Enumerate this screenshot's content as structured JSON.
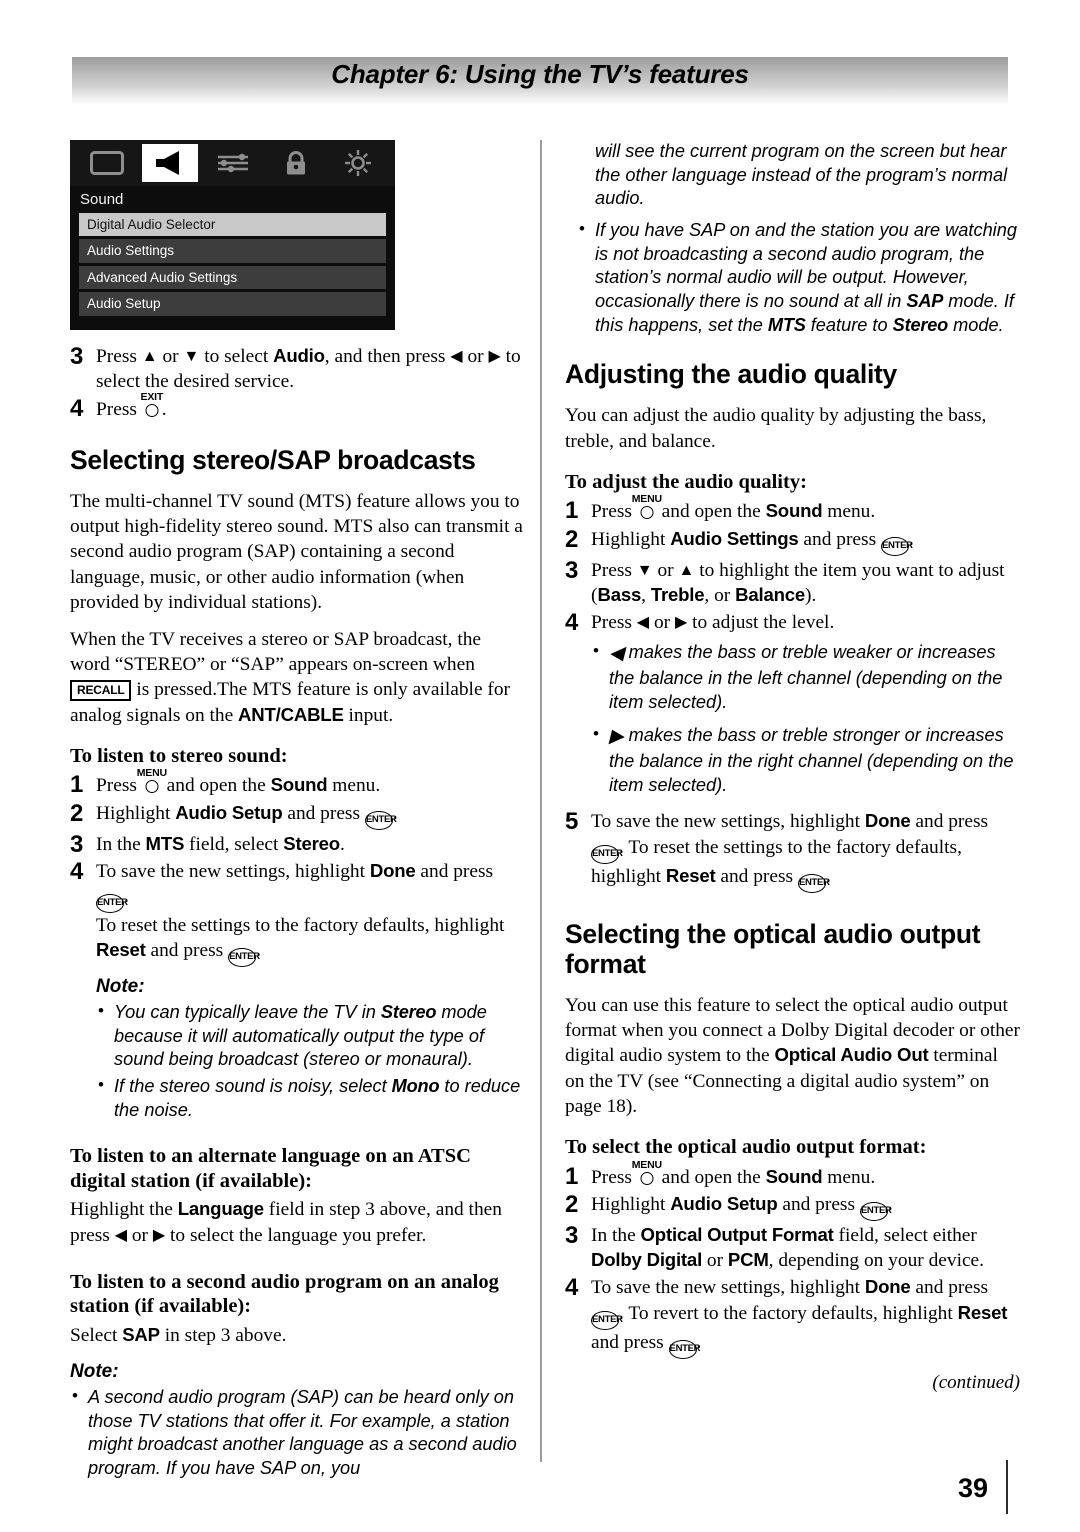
{
  "header": {
    "chapter_title": "Chapter 6: Using the TV’s features"
  },
  "page": {
    "number": "39",
    "continued_note": "(continued)"
  },
  "tv_menu": {
    "icons": [
      "picture-icon",
      "sound-icon",
      "settings-sliders-icon",
      "lock-icon",
      "brightness-sun-icon"
    ],
    "active_icon_index": 1,
    "title": "Sound",
    "items": [
      {
        "label": "Digital Audio Selector",
        "selected": true
      },
      {
        "label": "Audio Settings",
        "selected": false
      },
      {
        "label": "Advanced Audio Settings",
        "selected": false
      },
      {
        "label": "Audio Setup",
        "selected": false
      }
    ]
  },
  "left_column": {
    "step3": {
      "num": "3",
      "t1": "Press ",
      "up": "▲",
      "t2": " or ",
      "down": "▼",
      "t3": " to select ",
      "audio": "Audio",
      "t4": ", and then press ",
      "left": "◀",
      "t5": " or ",
      "right": "▶",
      "t6": " to select the desired service."
    },
    "step4": {
      "num": "4",
      "t1": "Press ",
      "exit_label": "EXIT",
      "t2": "."
    },
    "heading_stereo_sap": "Selecting stereo/SAP broadcasts",
    "para1": "The multi-channel TV sound (MTS) feature allows you to output high-fidelity stereo sound. MTS also can transmit a second audio program (SAP) containing a second language, music, or other audio information (when provided by individual stations).",
    "para2": {
      "t1": "When the TV receives a stereo or SAP broadcast, the word “STEREO” or “SAP” appears on-screen when ",
      "recall": "RECALL",
      "t2": " is pressed.The MTS feature is only available for analog signals on the ",
      "ant_cable": "ANT/CABLE",
      "t3": " input."
    },
    "sub_stereo": "To listen to stereo sound:",
    "s1": {
      "num": "1",
      "t1": "Press ",
      "menu_label": "MENU",
      "t2": " and open the ",
      "sound": "Sound",
      "t3": " menu."
    },
    "s2": {
      "num": "2",
      "t1": "Highlight ",
      "audio_setup": "Audio Setup",
      "t2": " and press ",
      "enter": "ENTER",
      "t3": "."
    },
    "s3": {
      "num": "3",
      "t1": "In the ",
      "mts": "MTS",
      "t2": " field, select ",
      "stereo": "Stereo",
      "t3": "."
    },
    "s4": {
      "num": "4",
      "t1": "To save the new settings, highlight ",
      "done": "Done",
      "t2": " and press ",
      "enter": "ENTER",
      "t3": ".",
      "line2": "To reset the settings to the factory defaults, highlight ",
      "reset": "Reset",
      "line3": " and press ",
      "enter2": "ENTER",
      "line4": "."
    },
    "note1_label": "Note:",
    "note1_b1": {
      "t1": "You can typically leave the TV in ",
      "stereo": "Stereo",
      "t2": " mode because it will automatically output the type of sound being broadcast (stereo or monaural)."
    },
    "note1_b2": {
      "t1": "If the stereo sound is noisy, select ",
      "mono": "Mono",
      "t2": " to reduce the noise."
    },
    "sub_altlang": "To listen to an alternate language on an ATSC digital station (if available):",
    "altlang_body": {
      "t1": "Highlight the ",
      "language": "Language",
      "t2": " field in step 3 above, and then press ",
      "left": "◀",
      "t3": " or ",
      "right": "▶",
      "t4": " to select the language you prefer."
    },
    "sub_sap": "To listen to a second audio program on an analog station (if available):",
    "sap_body": {
      "t1": "Select ",
      "sap": "SAP",
      "t2": " in step 3 above."
    },
    "note2_label": "Note:",
    "note2_b1": "A second audio program (SAP) can be heard only on those TV stations that offer it. For example, a station might broadcast another language as a second audio program. If you have SAP on, you"
  },
  "right_column": {
    "cont_text": "will see the current program on the screen but hear the other language instead of the program’s normal audio.",
    "note_b2": {
      "t1": "If you have SAP on and the station you are watching is not broadcasting a second audio program, the station’s normal audio will be output. However, occasionally there is no sound at all in ",
      "sap": "SAP",
      "t2": " mode. If this happens, set the ",
      "mts": "MTS",
      "t3": " feature to ",
      "stereo": "Stereo",
      "t4": " mode."
    },
    "heading_audio_quality": "Adjusting the audio quality",
    "para1": "You can adjust the audio quality by adjusting the bass, treble, and balance.",
    "sub_adjust": "To adjust the audio quality:",
    "a1": {
      "num": "1",
      "t1": "Press ",
      "menu_label": "MENU",
      "t2": " and open the ",
      "sound": "Sound",
      "t3": " menu."
    },
    "a2": {
      "num": "2",
      "t1": "Highlight ",
      "audio_settings": "Audio Settings",
      "t2": " and press ",
      "enter": "ENTER",
      "t3": "."
    },
    "a3": {
      "num": "3",
      "t1": "Press ",
      "down": "▼",
      "t2": " or ",
      "up": "▲",
      "t3": " to highlight the item you want to adjust (",
      "bass": "Bass",
      "t4": ", ",
      "treble": "Treble",
      "t5": ", or ",
      "balance": "Balance",
      "t6": ")."
    },
    "a4": {
      "num": "4",
      "t1": "Press ",
      "left": "◀",
      "t2": " or ",
      "right": "▶",
      "t3": " to adjust the level."
    },
    "a4_b1": {
      "arrow": "◀",
      "text": " makes the bass or treble weaker or increases the balance in the left channel (depending on the item selected)."
    },
    "a4_b2": {
      "arrow": "▶",
      "text": " makes the bass or treble stronger or increases the balance in the right channel (depending on the item selected)."
    },
    "a5": {
      "num": "5",
      "t1": "To save the new settings, highlight ",
      "done": "Done",
      "t2": " and press ",
      "enter": "ENTER",
      "t3": ". To reset the settings to the factory defaults, highlight ",
      "reset": "Reset",
      "t4": " and press ",
      "enter2": "ENTER",
      "t5": "."
    },
    "heading_optical": "Selecting the optical audio output format",
    "para2": {
      "t1": "You can use this feature to select the optical audio output format when you connect a Dolby Digital decoder or other digital audio system to the ",
      "optical": "Optical Audio Out",
      "t2": " terminal on the TV (see “Connecting a digital audio system” on page 18)."
    },
    "sub_optical": "To select the optical audio output format:",
    "o1": {
      "num": "1",
      "t1": "Press ",
      "menu_label": "MENU",
      "t2": " and open the ",
      "sound": "Sound",
      "t3": " menu."
    },
    "o2": {
      "num": "2",
      "t1": "Highlight ",
      "audio_setup": "Audio Setup",
      "t2": " and press ",
      "enter": "ENTER",
      "t3": "."
    },
    "o3": {
      "num": "3",
      "t1": "In the ",
      "field": "Optical Output Format",
      "t2": " field, select either ",
      "dolby": "Dolby Digital",
      "t3": " or ",
      "pcm": "PCM",
      "t4": ", depending on your device."
    },
    "o4": {
      "num": "4",
      "t1": "To save the new settings, highlight ",
      "done": "Done",
      "t2": " and press ",
      "enter": "ENTER",
      "t3": ". To revert to the factory defaults, highlight ",
      "reset": "Reset",
      "t4": " and press ",
      "enter2": "ENTER",
      "t5": "."
    }
  }
}
